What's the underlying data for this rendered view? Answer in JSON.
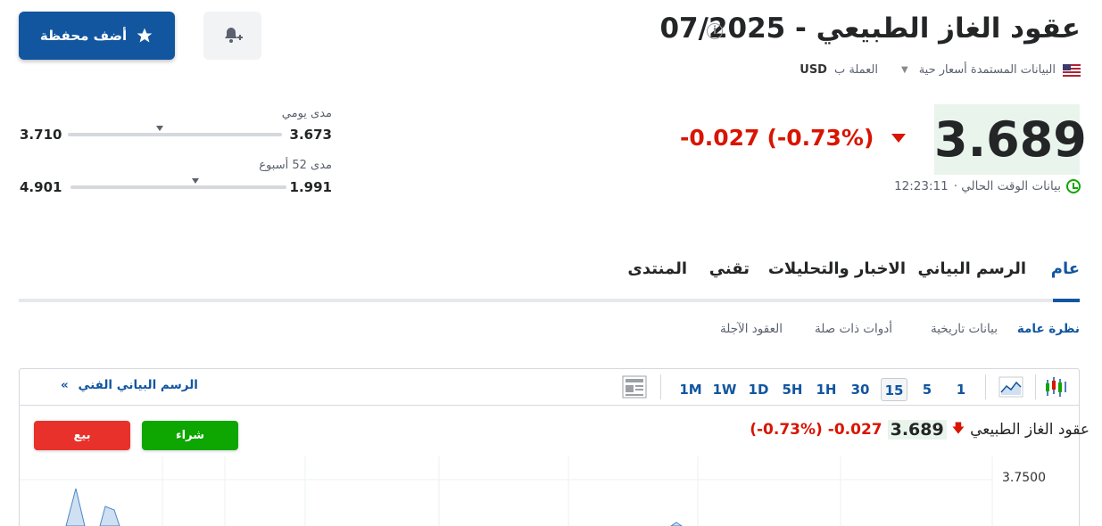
{
  "header": {
    "title": "عقود الغاز الطبيعي - 07/2025",
    "info_icon": "info-icon",
    "realtime_label": "البيانات المستمدة أسعار حية",
    "currency_label": "العملة ب",
    "currency": "USD",
    "add_portfolio_label": "أضف محفظة",
    "alert_icon": "bell-plus-icon"
  },
  "quote": {
    "price": "3.689",
    "change": "-0.027",
    "change_pct": "(-0.73%)",
    "time_label": "بيانات الوقت الحالي ·",
    "time": "12:23:11"
  },
  "ranges": {
    "daily": {
      "label": "مدى يومي",
      "low": "3.673",
      "high": "3.710",
      "marker_fraction": 0.43
    },
    "week52": {
      "label": "مدى 52 أسبوع",
      "low": "1.991",
      "high": "4.901",
      "marker_fraction": 0.58
    }
  },
  "tabs": [
    {
      "label": "عام",
      "active": true
    },
    {
      "label": "الرسم البياني",
      "active": false
    },
    {
      "label": "الاخبار والتحليلات",
      "active": false
    },
    {
      "label": "تقني",
      "active": false
    },
    {
      "label": "المنتدى",
      "active": false
    }
  ],
  "subtabs": [
    {
      "label": "نظرة عامة",
      "active": true
    },
    {
      "label": "بيانات تاريخية",
      "active": false
    },
    {
      "label": "أدوات ذات صلة",
      "active": false
    },
    {
      "label": "العقود الآجلة",
      "active": false
    }
  ],
  "chart_toolbar": {
    "periods": [
      "1",
      "5",
      "15",
      "30",
      "1H",
      "5H",
      "1D",
      "1W",
      "1M"
    ],
    "selected_period": "15",
    "tech_chart_link": "الرسم البياني الفني",
    "tech_chart_arrow": "»"
  },
  "chart_widget": {
    "name": "عقود الغاز الطبيعي",
    "price": "3.689",
    "change": "-0.027",
    "change_pct": "(-0.73%)",
    "buy_label": "شراء",
    "sell_label": "بيع",
    "y_axis_top": "3.7500"
  },
  "colors": {
    "brand_blue": "#1256a0",
    "down_red": "#d91400",
    "up_green": "#0ea600",
    "price_bg": "#e8f4ec"
  }
}
